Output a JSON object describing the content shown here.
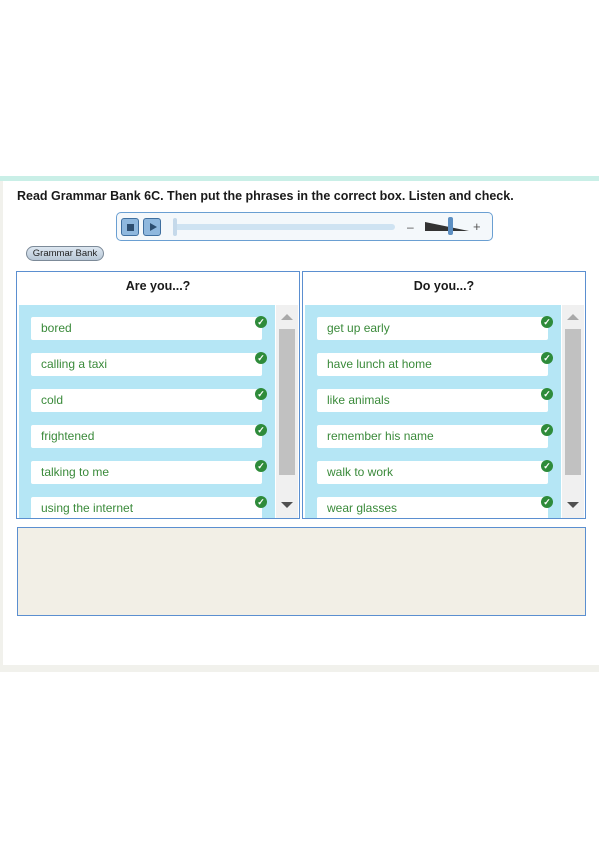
{
  "instruction": "Read Grammar Bank 6C. Then put the phrases in the correct box. Listen and check.",
  "player": {
    "stop_icon": "stop-icon",
    "play_icon": "play-icon",
    "volume_minus": "–",
    "volume_plus": "+"
  },
  "grammar_bank_button": "Grammar Bank",
  "boxes": [
    {
      "title": "Are you...?",
      "items": [
        "bored",
        "calling a taxi",
        "cold",
        "frightened",
        "talking to me",
        "using the internet"
      ]
    },
    {
      "title": "Do you...?",
      "items": [
        "get up early",
        "have lunch at home",
        "like animals",
        "remember his name",
        "walk to work",
        "wear glasses"
      ]
    }
  ],
  "check_icon": "checkmark-icon",
  "colors": {
    "list_background": "#b5e6f5",
    "item_text": "#3a8a3a",
    "check": "#2e8b3a",
    "border": "#5b8fd0",
    "drop_area": "#f2efe6"
  }
}
